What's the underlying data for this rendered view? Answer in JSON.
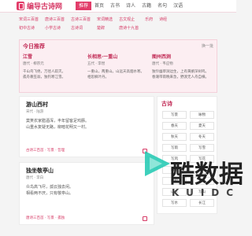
{
  "header": {
    "logo_text": "编导古诗网",
    "nav": [
      "推荐",
      "首页",
      "古书",
      "诗人",
      "古籍",
      "名句",
      "汉语"
    ]
  },
  "subnav": [
    "宋词三百首",
    "唐诗三百首",
    "古诗三百首",
    "宋词精选",
    "古文观止",
    "乐府",
    "诗经",
    "初中古诗",
    "小学古诗",
    "古诗词",
    "楚辞",
    "唐诗十九首"
  ],
  "recommend": {
    "heading": "今日推荐",
    "more": "换一批",
    "cards": [
      {
        "title": "江雪",
        "author": "唐代 · 柳宗元",
        "lines": [
          "千山鸟飞绝，万径人踪灭。",
          "孤舟蓑笠翁，独钓寒江雪。"
        ]
      },
      {
        "title": "长相思·一重山",
        "author": "五代 · 李煜",
        "lines": [
          "一重山，两重山。山远天高烟水寒。",
          "相思枫叶丹。"
        ]
      },
      {
        "title": "图州西涧",
        "author": "唐代 · 韦应物",
        "lines": [
          "独怜幽草涧边生，上有黄鹂深树鸣。",
          "春潮带雨晚来急，野渡无人舟自横。"
        ]
      }
    ]
  },
  "poems": [
    {
      "title": "游山西村",
      "author": "宋代 · 陆游",
      "lines": [
        "莫笑农家腊酒浑，丰年留客足鸡豚。",
        "山重水复疑无路，柳暗花明又一村。"
      ],
      "tags": "古诗三百首 · 写景 · 哲理"
    },
    {
      "title": "独坐敬亭山",
      "author": "唐代 · 李白",
      "lines": [
        "众鸟高飞尽，孤云独去闲。",
        "相看两不厌，只有敬亭山。"
      ],
      "tags": "唐诗三百首 · 写景 · 孤独"
    }
  ],
  "sidebar": {
    "heading": "古诗",
    "items": [
      "写景",
      "咏物",
      "春天",
      "夏天",
      "秋天",
      "冬天",
      "写雨",
      "写雪",
      "写风",
      "写花",
      "梅花",
      "荷花",
      "柳树",
      "月亮",
      "山水",
      "写山",
      "写水",
      "长江"
    ]
  },
  "watermark": {
    "text": "酷数据",
    "sub": "KUIDC"
  },
  "colors": {
    "accent": "#e23d6a",
    "brand": "#d63965",
    "rec_bg": "#fceef2"
  }
}
